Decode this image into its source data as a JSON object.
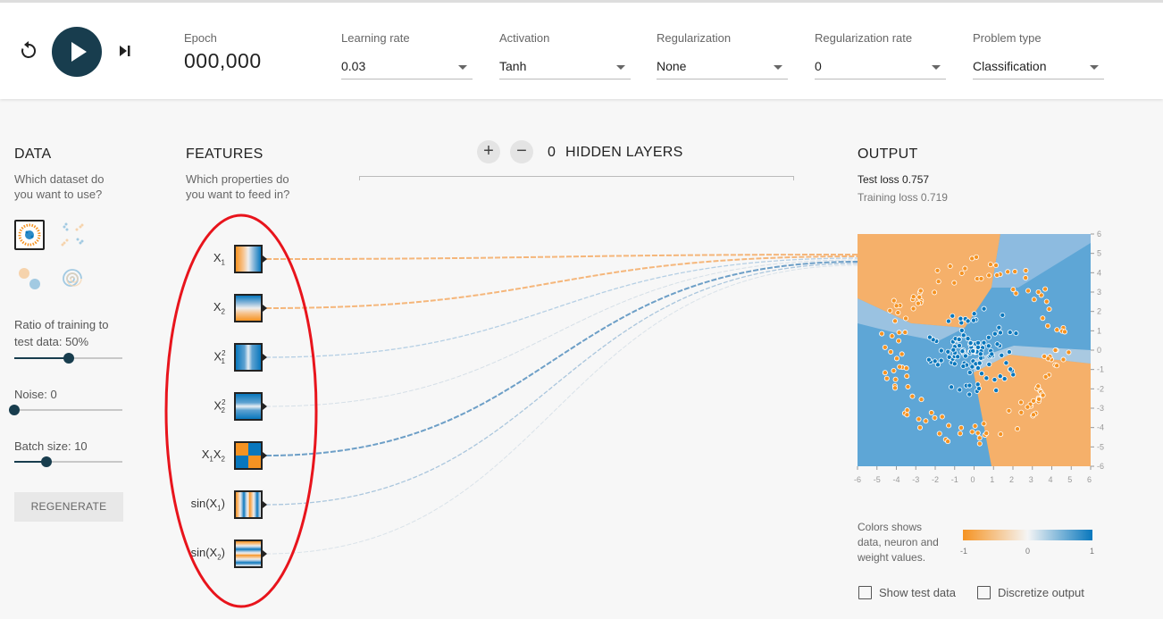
{
  "controls": {
    "reset_icon": "reset-icon",
    "play_icon": "play-icon",
    "step_icon": "step-icon"
  },
  "epoch": {
    "label": "Epoch",
    "value": "000,000"
  },
  "dropdowns": [
    {
      "label": "Learning rate",
      "value": "0.03"
    },
    {
      "label": "Activation",
      "value": "Tanh"
    },
    {
      "label": "Regularization",
      "value": "None"
    },
    {
      "label": "Regularization rate",
      "value": "0"
    },
    {
      "label": "Problem type",
      "value": "Classification"
    }
  ],
  "data_section": {
    "title": "DATA",
    "subtitle_line1": "Which dataset do",
    "subtitle_line2": "you want to use?",
    "datasets": [
      "circle",
      "xor",
      "gauss",
      "spiral"
    ],
    "selected_dataset": "circle",
    "ratio_label_line1": "Ratio of training to",
    "ratio_label_line2": "test data:  50%",
    "ratio_value": 0.5,
    "noise_label": "Noise:  0",
    "noise_value": 0,
    "batch_label": "Batch size:  10",
    "batch_value": 0.3,
    "regenerate_label": "REGENERATE"
  },
  "features_section": {
    "title": "FEATURES",
    "subtitle_line1": "Which properties do",
    "subtitle_line2": "you want to feed in?",
    "features": [
      {
        "label": "X",
        "sub": "1",
        "sup": ""
      },
      {
        "label": "X",
        "sub": "2",
        "sup": ""
      },
      {
        "label": "X",
        "sub": "1",
        "sup": "2"
      },
      {
        "label": "X",
        "sub": "2",
        "sup": "2"
      },
      {
        "label": "X1X2",
        "sub": "",
        "sup": ""
      },
      {
        "label": "sin(X",
        "sub": "1",
        "sup": "",
        "suffix": ")"
      },
      {
        "label": "sin(X",
        "sub": "2",
        "sup": "",
        "suffix": ")"
      }
    ]
  },
  "hidden_layers": {
    "count": "0",
    "label": "HIDDEN LAYERS",
    "add_label": "+",
    "remove_label": "−"
  },
  "output": {
    "title": "OUTPUT",
    "test_loss": "Test loss 0.757",
    "training_loss": "Training loss 0.719",
    "y_ticks": [
      "6",
      "5",
      "4",
      "3",
      "2",
      "1",
      "0",
      "-1",
      "-2",
      "-3",
      "-4",
      "-5",
      "-6"
    ],
    "x_ticks": [
      "-6",
      "-5",
      "-4",
      "-3",
      "-2",
      "-1",
      "0",
      "1",
      "2",
      "3",
      "4",
      "5",
      "6"
    ],
    "legend_text_line1": "Colors shows",
    "legend_text_line2": "data, neuron and",
    "legend_text_line3": "weight values.",
    "legend_ticks": [
      "-1",
      "0",
      "1"
    ],
    "show_test_data": "Show test data",
    "discretize_output": "Discretize output"
  },
  "colors": {
    "orange": "#f59322",
    "blue": "#0877bd",
    "dark": "#183d4e",
    "highlight_ellipse": "#e8141c"
  }
}
